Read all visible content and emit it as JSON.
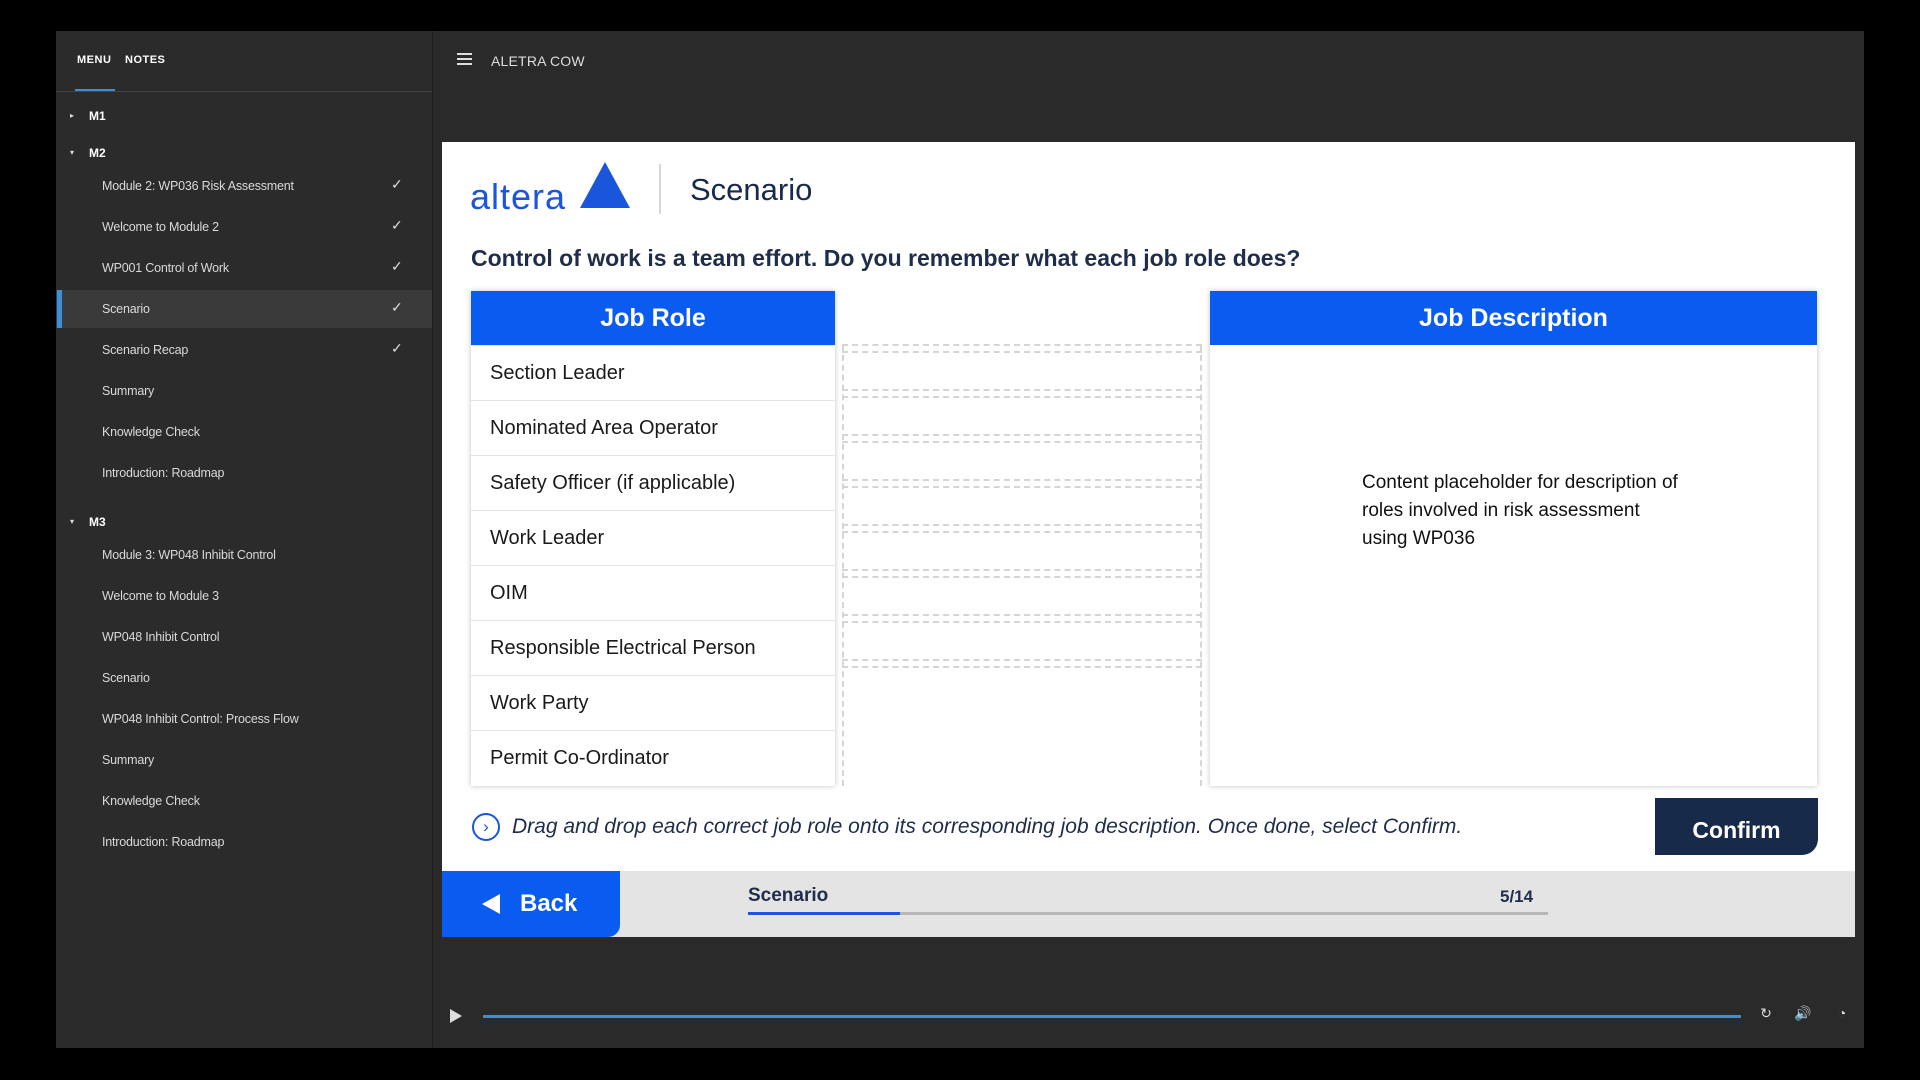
{
  "sidebar": {
    "tabs": {
      "menu": "MENU",
      "notes": "NOTES"
    },
    "groups": [
      {
        "label": "M1",
        "caret": "▸"
      },
      {
        "label": "M2",
        "caret": "▾",
        "items": [
          {
            "label": "Module 2: WP036 Risk Assessment",
            "check": "✓"
          },
          {
            "label": "Welcome to Module 2",
            "check": "✓"
          },
          {
            "label": "WP001 Control of Work",
            "check": "✓"
          },
          {
            "label": "Scenario",
            "check": "✓",
            "active": true
          },
          {
            "label": "Scenario Recap",
            "check": "✓"
          },
          {
            "label": "Summary"
          },
          {
            "label": "Knowledge Check"
          },
          {
            "label": "Introduction: Roadmap"
          }
        ]
      },
      {
        "label": "M3",
        "caret": "▾",
        "items": [
          {
            "label": "Module 3: WP048 Inhibit Control"
          },
          {
            "label": "Welcome to Module 3"
          },
          {
            "label": "WP048 Inhibit Control"
          },
          {
            "label": "Scenario"
          },
          {
            "label": "WP048 Inhibit Control: Process Flow"
          },
          {
            "label": "Summary"
          },
          {
            "label": "Knowledge Check"
          },
          {
            "label": "Introduction: Roadmap"
          }
        ]
      }
    ]
  },
  "topbar": {
    "course_title": "ALETRA COW"
  },
  "slide": {
    "logo_text": "altera",
    "title": "Scenario",
    "question": "Control of work is a team effort. Do you remember what each job role does?",
    "role_header": "Job Role",
    "roles": [
      "Section Leader",
      "Nominated Area Operator",
      "Safety Officer (if applicable)",
      "Work Leader",
      "OIM",
      "Responsible Electrical Person",
      "Work Party",
      "Permit Co-Ordinator"
    ],
    "desc_header": "Job Description",
    "desc_text": "Content placeholder for description of roles involved in risk assessment using WP036",
    "instruction_icon": "›",
    "instruction": "Drag and drop each correct job role onto its corresponding job description. Once done, select Confirm.",
    "confirm_label": "Confirm"
  },
  "footer": {
    "back_label": "Back",
    "progress_label": "Scenario",
    "progress_count": "5/14",
    "progress_fraction": 0.19
  },
  "player": {
    "icons": [
      "play-icon",
      "replay-icon",
      "volume-icon",
      "speed-icon"
    ],
    "accent": "#3a8fd6"
  },
  "colors": {
    "brand_blue": "#0a5cf0",
    "navy": "#172a4a",
    "sidebar_bg": "#2b2b2b"
  }
}
